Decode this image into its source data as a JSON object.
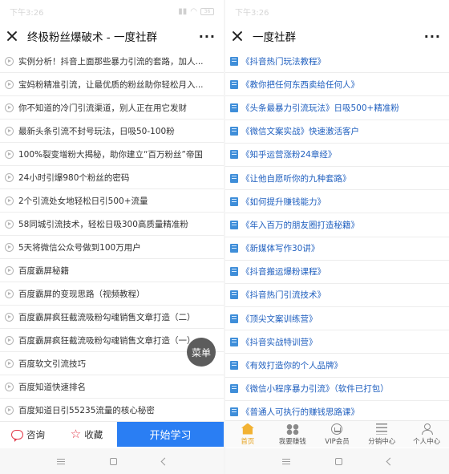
{
  "left": {
    "status_time": "下午3:26",
    "battery": "36",
    "title": "终极粉丝爆破术 - 一度社群",
    "more": "···",
    "items": [
      "实例分析！抖音上面那些暴力引流的套路，加人...",
      "宝妈粉精准引流，让最优质的粉丝助你轻松月入...",
      "你不知道的冷门引流渠道，别人正在用它发财",
      "最新头条引流不封号玩法，日吸50-100粉",
      "100%裂变增粉大揭秘，助你建立“百万粉丝”帝国",
      "24小时引爆980个粉丝的密码",
      "2个引流处女地轻松日引500+流量",
      "58同城引流技术，轻松日吸300高质量精准粉",
      "5天将微信公众号做到100万用户",
      "百度霸屏秘籍",
      "百度霸屏的变现思路（视频教程）",
      "百度霸屏疯狂截流吸粉勾魂销售文章打造（二）",
      "百度霸屏疯狂截流吸粉勾魂销售文章打造（一）",
      "百度软文引流技巧",
      "百度知道快速排名",
      "百度知道日引55235流量的核心秘密"
    ],
    "float_menu": "菜单",
    "bottom": {
      "consult": "咨询",
      "favorite": "收藏",
      "start": "开始学习"
    },
    "accent": "#2a7ef3"
  },
  "right": {
    "status_time": "下午3:26",
    "title": "一度社群",
    "more": "···",
    "items": [
      "《抖音热门玩法教程》",
      "《教你把任何东西卖给任何人》",
      "《头条最暴力引流玩法》日吸500+精准粉",
      "《微信文案实战》快速激活客户",
      "《知乎运营涨粉24章经》",
      "《让他自愿听你的九种套路》",
      "《如何提升赚钱能力》",
      "《年入百万的朋友圈打造秘籍》",
      "《新媒体写作30讲》",
      "《抖音搬运爆粉课程》",
      "《抖音热门引流技术》",
      "《顶尖文案训练营》",
      "《抖音实战特训营》",
      "《有效打造你的个人品牌》",
      "《微信小程序暴力引流》（软件已打包）",
      "《普通人可执行的赚钱思路课》"
    ],
    "tabs": [
      {
        "label": "首页",
        "icon": "home-icon"
      },
      {
        "label": "我要赚钱",
        "icon": "grid-icon"
      },
      {
        "label": "VIP会员",
        "icon": "vip-icon"
      },
      {
        "label": "分销中心",
        "icon": "list-icon"
      },
      {
        "label": "个人中心",
        "icon": "user-icon"
      }
    ],
    "link_color": "#1f5fbf",
    "active_tab_color": "#e6a11b"
  }
}
